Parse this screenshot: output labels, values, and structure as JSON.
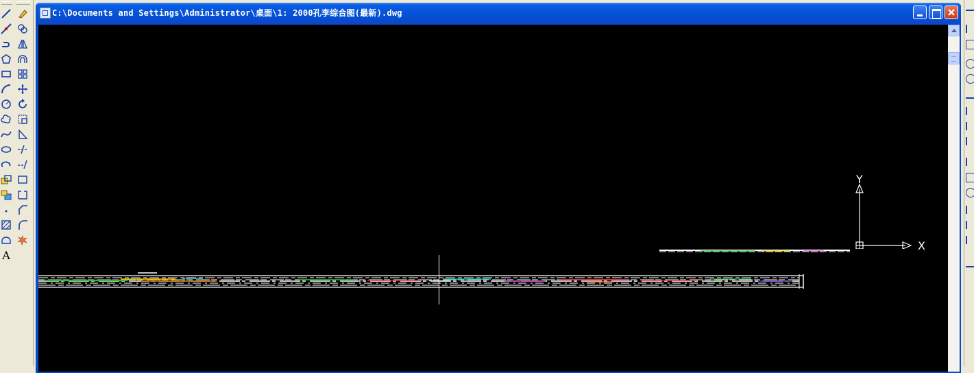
{
  "window": {
    "title": "C:\\Documents and Settings\\Administrator\\桌面\\1: 2000孔李综合图(最新).dwg"
  },
  "ucs": {
    "x_label": "X",
    "y_label": "Y"
  },
  "draw_toolbar": {
    "text_tool_label": "A"
  },
  "colors": {
    "drawing_background": "#000000",
    "title_bar": "#0453d8",
    "toolbar_background": "#ece9d8"
  }
}
